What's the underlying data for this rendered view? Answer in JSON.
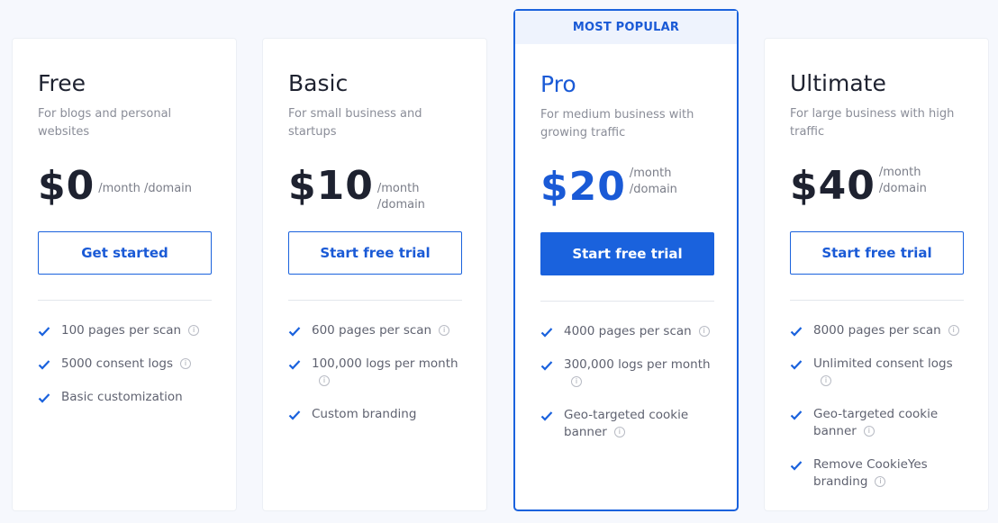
{
  "colors": {
    "accent": "#1a62dd",
    "badge_bg": "#eef3fd",
    "page_bg": "#f6f8fd"
  },
  "plans": [
    {
      "name": "Free",
      "desc": "For blogs and personal websites",
      "price": "$0",
      "per": "/month /domain",
      "button": "Get started",
      "features": [
        {
          "text": "100 pages per scan",
          "info": true
        },
        {
          "text": "5000 consent logs",
          "info": true
        },
        {
          "text": "Basic customization",
          "info": false
        }
      ]
    },
    {
      "name": "Basic",
      "desc": "For small business and startups",
      "price": "$10",
      "per": "/month /domain",
      "button": "Start free trial",
      "features": [
        {
          "text": "600 pages per scan",
          "info": true
        },
        {
          "text": "100,000 logs per month",
          "info": true
        },
        {
          "text": "Custom branding",
          "info": false
        }
      ]
    },
    {
      "name": "Pro",
      "badge": "MOST POPULAR",
      "desc": "For medium business with growing traffic",
      "price": "$20",
      "per": "/month /domain",
      "button": "Start free trial",
      "features": [
        {
          "text": "4000 pages per scan",
          "info": true
        },
        {
          "text": "300,000 logs per month",
          "info": true
        },
        {
          "text": "Geo-targeted cookie banner",
          "info": true
        }
      ]
    },
    {
      "name": "Ultimate",
      "desc": "For large business with high traffic",
      "price": "$40",
      "per": "/month /domain",
      "button": "Start free trial",
      "features": [
        {
          "text": "8000 pages per scan",
          "info": true
        },
        {
          "text": "Unlimited consent logs",
          "info": true
        },
        {
          "text": "Geo-targeted cookie banner",
          "info": true
        },
        {
          "text": "Remove CookieYes branding",
          "info": true
        }
      ]
    }
  ]
}
